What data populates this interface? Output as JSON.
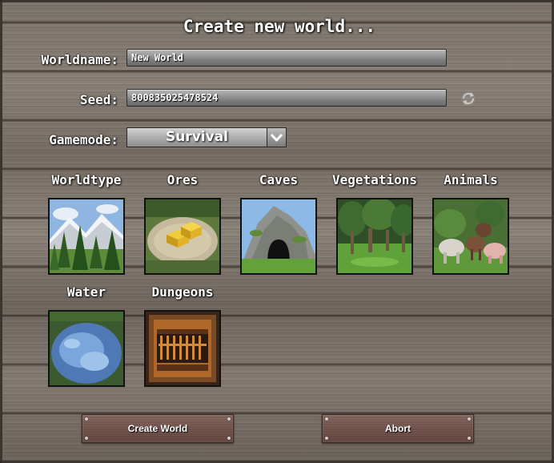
{
  "dialog": {
    "title": "Create new world..."
  },
  "worldname": {
    "label": "Worldname:",
    "value": "New World"
  },
  "seed": {
    "label": "Seed:",
    "value": "800835025478524",
    "reset_icon": "refresh-icon"
  },
  "gamemode": {
    "label": "Gamemode:",
    "selected": "Survival"
  },
  "options": [
    {
      "label": "Worldtype",
      "icon": "mountain-forest-thumbnail"
    },
    {
      "label": "Ores",
      "icon": "gold-ore-thumbnail"
    },
    {
      "label": "Caves",
      "icon": "cave-thumbnail"
    },
    {
      "label": "Vegetations",
      "icon": "trees-thumbnail"
    },
    {
      "label": "Animals",
      "icon": "animals-thumbnail"
    },
    {
      "label": "Water",
      "icon": "water-thumbnail"
    },
    {
      "label": "Dungeons",
      "icon": "dungeon-gate-thumbnail"
    }
  ],
  "buttons": {
    "create": "Create World",
    "abort": "Abort"
  },
  "colors": {
    "wood": "#7d756d",
    "button": "#7a5a52",
    "text": "#ffffff"
  }
}
